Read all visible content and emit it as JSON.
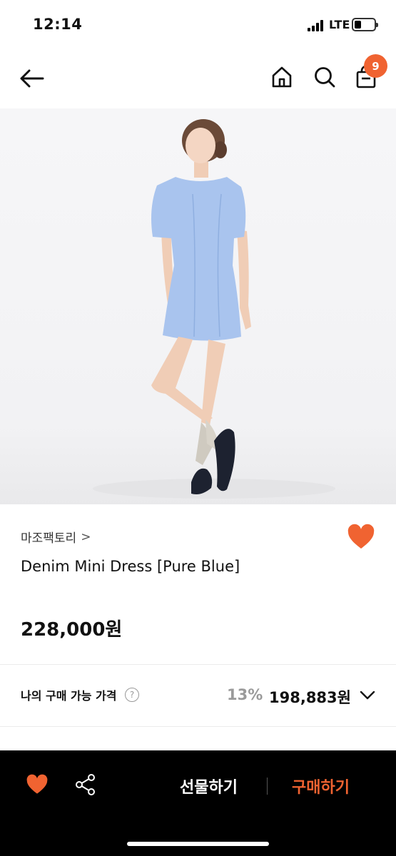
{
  "status_bar": {
    "time": "12:14",
    "network": "LTE"
  },
  "header": {
    "back_icon": "arrow-left-icon",
    "home_icon": "home-icon",
    "search_icon": "search-icon",
    "cart_icon": "shopping-bag-icon",
    "cart_count": "9"
  },
  "product": {
    "image_alt": "model wearing light blue denim mini dress",
    "brand": "마조팩토리",
    "brand_chevron": ">",
    "name": "Denim Mini Dress [Pure Blue]",
    "price": "228,000원",
    "favorited": true
  },
  "my_price": {
    "label": "나의 구매 가능 가격",
    "help": "?",
    "discount": "13%",
    "price": "198,883원"
  },
  "bottom_bar": {
    "gift_label": "선물하기",
    "buy_label": "구매하기"
  },
  "colors": {
    "accent": "#f06331",
    "bottom_bar_bg": "#000000",
    "dress": "#a9c4ee"
  }
}
